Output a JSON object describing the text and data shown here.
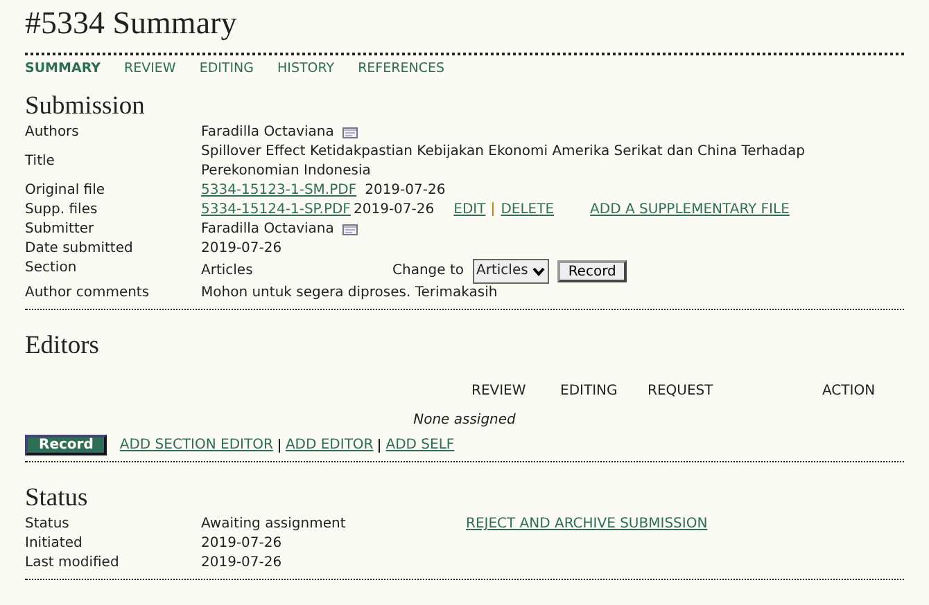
{
  "title": "#5334 Summary",
  "tabs": [
    {
      "label": "SUMMARY",
      "selected": true
    },
    {
      "label": "REVIEW",
      "selected": false
    },
    {
      "label": "EDITING",
      "selected": false
    },
    {
      "label": "HISTORY",
      "selected": false
    },
    {
      "label": "REFERENCES",
      "selected": false
    }
  ],
  "submission": {
    "heading": "Submission",
    "rows": [
      {
        "kind": "person",
        "label": "Authors",
        "value": "Faradilla Octaviana"
      },
      {
        "kind": "text",
        "label": "Title",
        "value": "Spillover Effect Ketidakpastian Kebijakan Ekonomi Amerika Serikat dan China Terhadap Perekonomian Indonesia"
      },
      {
        "kind": "file",
        "label": "Original file",
        "file": "5334-15123-1-SM.PDF",
        "date": "2019-07-26"
      },
      {
        "kind": "supp",
        "label": "Supp. files",
        "file": "5334-15124-1-SP.PDF",
        "date": "2019-07-26",
        "actions": [
          "EDIT",
          "DELETE"
        ],
        "add_link": "ADD A SUPPLEMENTARY FILE"
      },
      {
        "kind": "person",
        "label": "Submitter",
        "value": "Faradilla Octaviana"
      },
      {
        "kind": "text",
        "label": "Date submitted",
        "value": "2019-07-26"
      },
      {
        "kind": "section",
        "label": "Section",
        "value": "Articles",
        "change_label": "Change to",
        "select": "Articles",
        "button": "Record"
      },
      {
        "kind": "text",
        "label": "Author comments",
        "value": "Mohon untuk segera diproses. Terimakasih"
      }
    ]
  },
  "editors": {
    "heading": "Editors",
    "columns": [
      "REVIEW",
      "EDITING",
      "REQUEST",
      "ACTION"
    ],
    "empty": "None assigned",
    "button": "Record",
    "links": [
      "ADD SECTION EDITOR",
      "ADD EDITOR",
      "ADD SELF"
    ]
  },
  "status": {
    "heading": "Status",
    "rows": [
      {
        "label": "Status",
        "value": "Awaiting assignment",
        "link": "REJECT AND ARCHIVE SUBMISSION"
      },
      {
        "label": "Initiated",
        "value": "2019-07-26"
      },
      {
        "label": "Last modified",
        "value": "2019-07-26"
      }
    ]
  }
}
